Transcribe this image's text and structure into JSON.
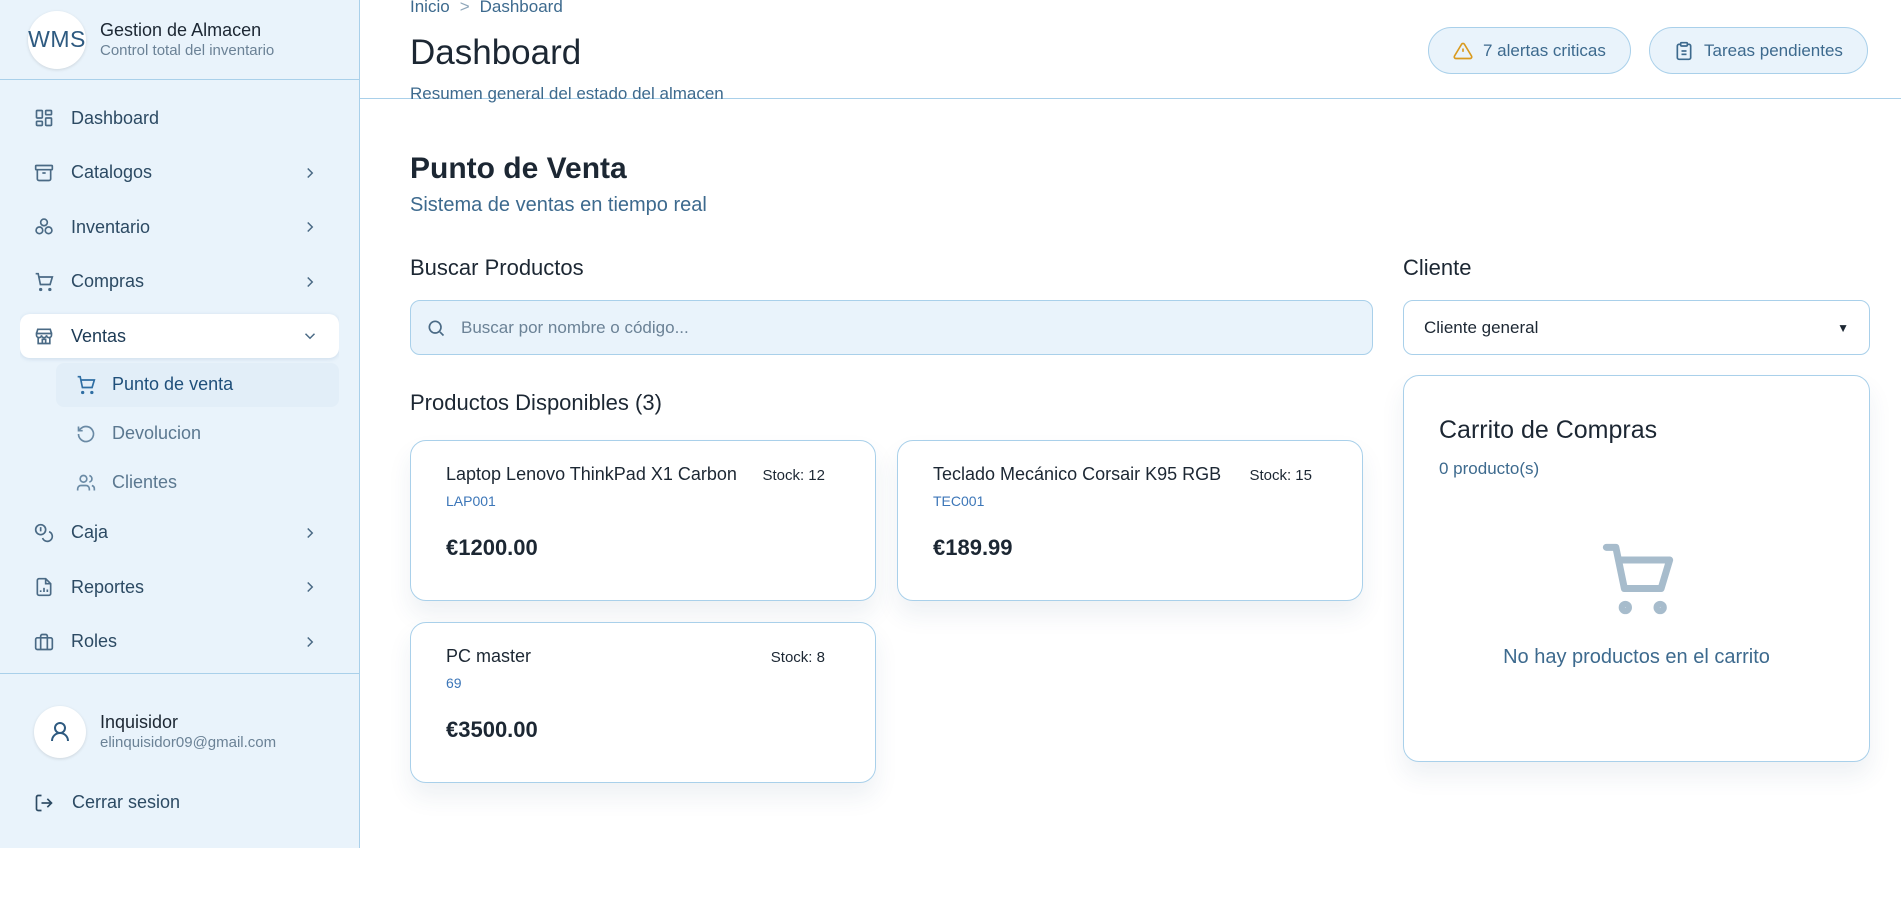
{
  "brand": {
    "logo": "WMS",
    "title": "Gestion de Almacen",
    "subtitle": "Control total del inventario"
  },
  "sidebar": {
    "items": [
      {
        "label": "Dashboard",
        "icon": "dashboard-icon"
      },
      {
        "label": "Catalogos",
        "icon": "archive-icon"
      },
      {
        "label": "Inventario",
        "icon": "boxes-icon"
      },
      {
        "label": "Compras",
        "icon": "cart-icon"
      },
      {
        "label": "Ventas",
        "icon": "store-icon"
      },
      {
        "label": "Caja",
        "icon": "coins-icon"
      },
      {
        "label": "Reportes",
        "icon": "report-icon"
      },
      {
        "label": "Roles",
        "icon": "briefcase-icon"
      }
    ],
    "ventas_sub": [
      {
        "label": "Punto de venta",
        "icon": "cart-icon"
      },
      {
        "label": "Devolucion",
        "icon": "rotate-ccw-icon"
      },
      {
        "label": "Clientes",
        "icon": "users-icon"
      }
    ]
  },
  "user": {
    "name": "Inquisidor",
    "email": "elinquisidor09@gmail.com",
    "logout": "Cerrar sesion"
  },
  "header": {
    "breadcrumb": [
      "Inicio",
      "Dashboard"
    ],
    "breadcrumb_sep": ">",
    "title": "Dashboard",
    "subtitle": "Resumen general del estado del almacen",
    "alerts_button": "7 alertas criticas",
    "tasks_button": "Tareas pendientes",
    "alerts_color": "#d99a1e"
  },
  "pos": {
    "title": "Punto de Venta",
    "subtitle": "Sistema de ventas en tiempo real",
    "search_title": "Buscar Productos",
    "search_placeholder": "Buscar por nombre o código...",
    "products_title": "Productos Disponibles (3)",
    "products": [
      {
        "name": "Laptop Lenovo ThinkPad X1 Carbon",
        "code": "LAP001",
        "stock": "Stock: 12",
        "price": "€1200.00"
      },
      {
        "name": "Teclado Mecánico Corsair K95 RGB",
        "code": "TEC001",
        "stock": "Stock: 15",
        "price": "€189.99"
      },
      {
        "name": "PC master",
        "code": "69",
        "stock": "Stock: 8",
        "price": "€3500.00"
      }
    ],
    "client_title": "Cliente",
    "client_selected": "Cliente general",
    "cart": {
      "title": "Carrito de Compras",
      "count": "0 producto(s)",
      "empty": "No hay productos en el carrito"
    }
  },
  "colors": {
    "accent": "#3d6a8e",
    "border": "#a9d0ea",
    "sidebar_bg": "#e9f3fb",
    "code_link": "#3c76b8"
  }
}
